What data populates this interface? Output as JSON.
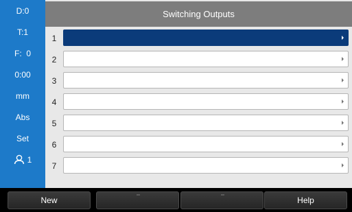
{
  "status_bar": {
    "datum": "D:0",
    "tool": "T:1",
    "feed": "F:  0",
    "timer": "0:00",
    "units": "mm",
    "mode": "Abs",
    "set": "Set",
    "operator_icon": "user-icon",
    "operator_number": "1"
  },
  "main": {
    "title": "Switching Outputs",
    "rows": [
      {
        "number": "1",
        "value": "",
        "selected": true
      },
      {
        "number": "2",
        "value": "",
        "selected": false
      },
      {
        "number": "3",
        "value": "",
        "selected": false
      },
      {
        "number": "4",
        "value": "",
        "selected": false
      },
      {
        "number": "5",
        "value": "",
        "selected": false
      },
      {
        "number": "6",
        "value": "",
        "selected": false
      },
      {
        "number": "7",
        "value": "",
        "selected": false
      }
    ]
  },
  "softkeys": {
    "key1": "New",
    "key2": "",
    "key3": "",
    "key4": "Help"
  },
  "colors": {
    "status_bar": "#1d7ac9",
    "selected_row": "#0b3b7a",
    "title_bar": "#7d7d7d"
  }
}
